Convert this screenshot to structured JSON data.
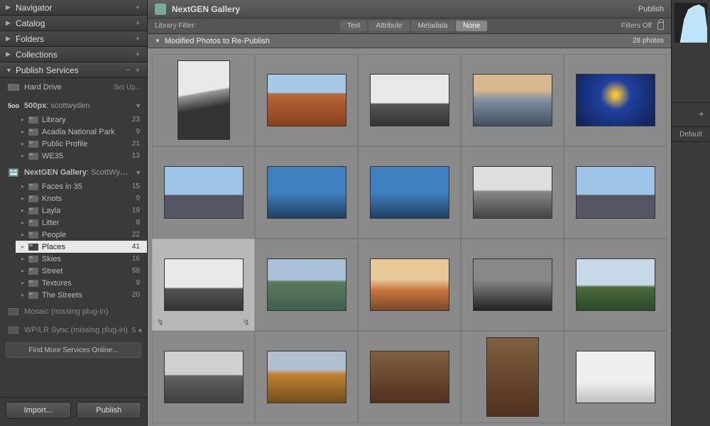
{
  "left": {
    "panels": [
      {
        "name": "Navigator",
        "open": false
      },
      {
        "name": "Catalog",
        "open": false
      },
      {
        "name": "Folders",
        "open": false
      },
      {
        "name": "Collections",
        "open": false
      }
    ],
    "publish_services": {
      "title": "Publish Services",
      "buttons": "−  +",
      "hard_drive": {
        "label": "Hard Drive",
        "setup": "Set Up..."
      },
      "px500": {
        "label": "500px",
        "user": "scottwyden",
        "items": [
          {
            "label": "Library",
            "count": 23
          },
          {
            "label": "Acadia National Park",
            "count": 9
          },
          {
            "label": "Public Profile",
            "count": 21
          },
          {
            "label": "WE35",
            "count": 13
          }
        ]
      },
      "nextgen": {
        "label": "NextGEN Gallery",
        "user": "ScottWyde…",
        "items": [
          {
            "label": "Faces in 35",
            "count": 15
          },
          {
            "label": "Knots",
            "count": 9
          },
          {
            "label": "Layla",
            "count": 19
          },
          {
            "label": "Litter",
            "count": 8
          },
          {
            "label": "People",
            "count": 22
          },
          {
            "label": "Places",
            "count": 41,
            "selected": true
          },
          {
            "label": "Skies",
            "count": 16
          },
          {
            "label": "Street",
            "count": 58
          },
          {
            "label": "Textures",
            "count": 9
          },
          {
            "label": "The Streets",
            "count": 20
          }
        ]
      },
      "missing": [
        {
          "label": "Mosaic (missing plug-in)"
        },
        {
          "label": "WP/LR Sync (missing plug-in)",
          "count": "5 ◂"
        }
      ],
      "find": "Find More Services Online..."
    },
    "footer": {
      "import": "Import...",
      "publish": "Publish"
    }
  },
  "main": {
    "header": {
      "title": "NextGEN Gallery",
      "publish": "Publish"
    },
    "filter": {
      "label": "Library Filter:",
      "tabs": [
        "Text",
        "Attribute",
        "Metadata",
        "None"
      ],
      "active": 3,
      "off": "Filters Off"
    },
    "section": {
      "label": "Modified Photos to Re-Publish",
      "count": "28 photos"
    },
    "rows": 4,
    "cols": 5,
    "thumbs": [
      {
        "o": "pt",
        "c": "t-arch"
      },
      {
        "o": "ls",
        "c": "t-rocks"
      },
      {
        "o": "ls",
        "c": "t-bw"
      },
      {
        "o": "ls",
        "c": "t-dusk"
      },
      {
        "o": "ls",
        "c": "t-night"
      },
      {
        "o": "ls",
        "c": "t-sky"
      },
      {
        "o": "ls",
        "c": "t-blue"
      },
      {
        "o": "ls",
        "c": "t-blue"
      },
      {
        "o": "ls",
        "c": "t-bw2"
      },
      {
        "o": "ls",
        "c": "t-sky"
      },
      {
        "o": "ls",
        "c": "t-bw",
        "sel": true
      },
      {
        "o": "ls",
        "c": "t-lake"
      },
      {
        "o": "ls",
        "c": "t-sunset"
      },
      {
        "o": "ls",
        "c": "t-dark"
      },
      {
        "o": "ls",
        "c": "t-tree"
      },
      {
        "o": "ls",
        "c": "t-city"
      },
      {
        "o": "ls",
        "c": "t-autumn"
      },
      {
        "o": "ls",
        "c": "t-indoor"
      },
      {
        "o": "pt",
        "c": "t-indoor"
      },
      {
        "o": "ls",
        "c": "t-light"
      }
    ]
  },
  "right": {
    "default": "Default"
  }
}
